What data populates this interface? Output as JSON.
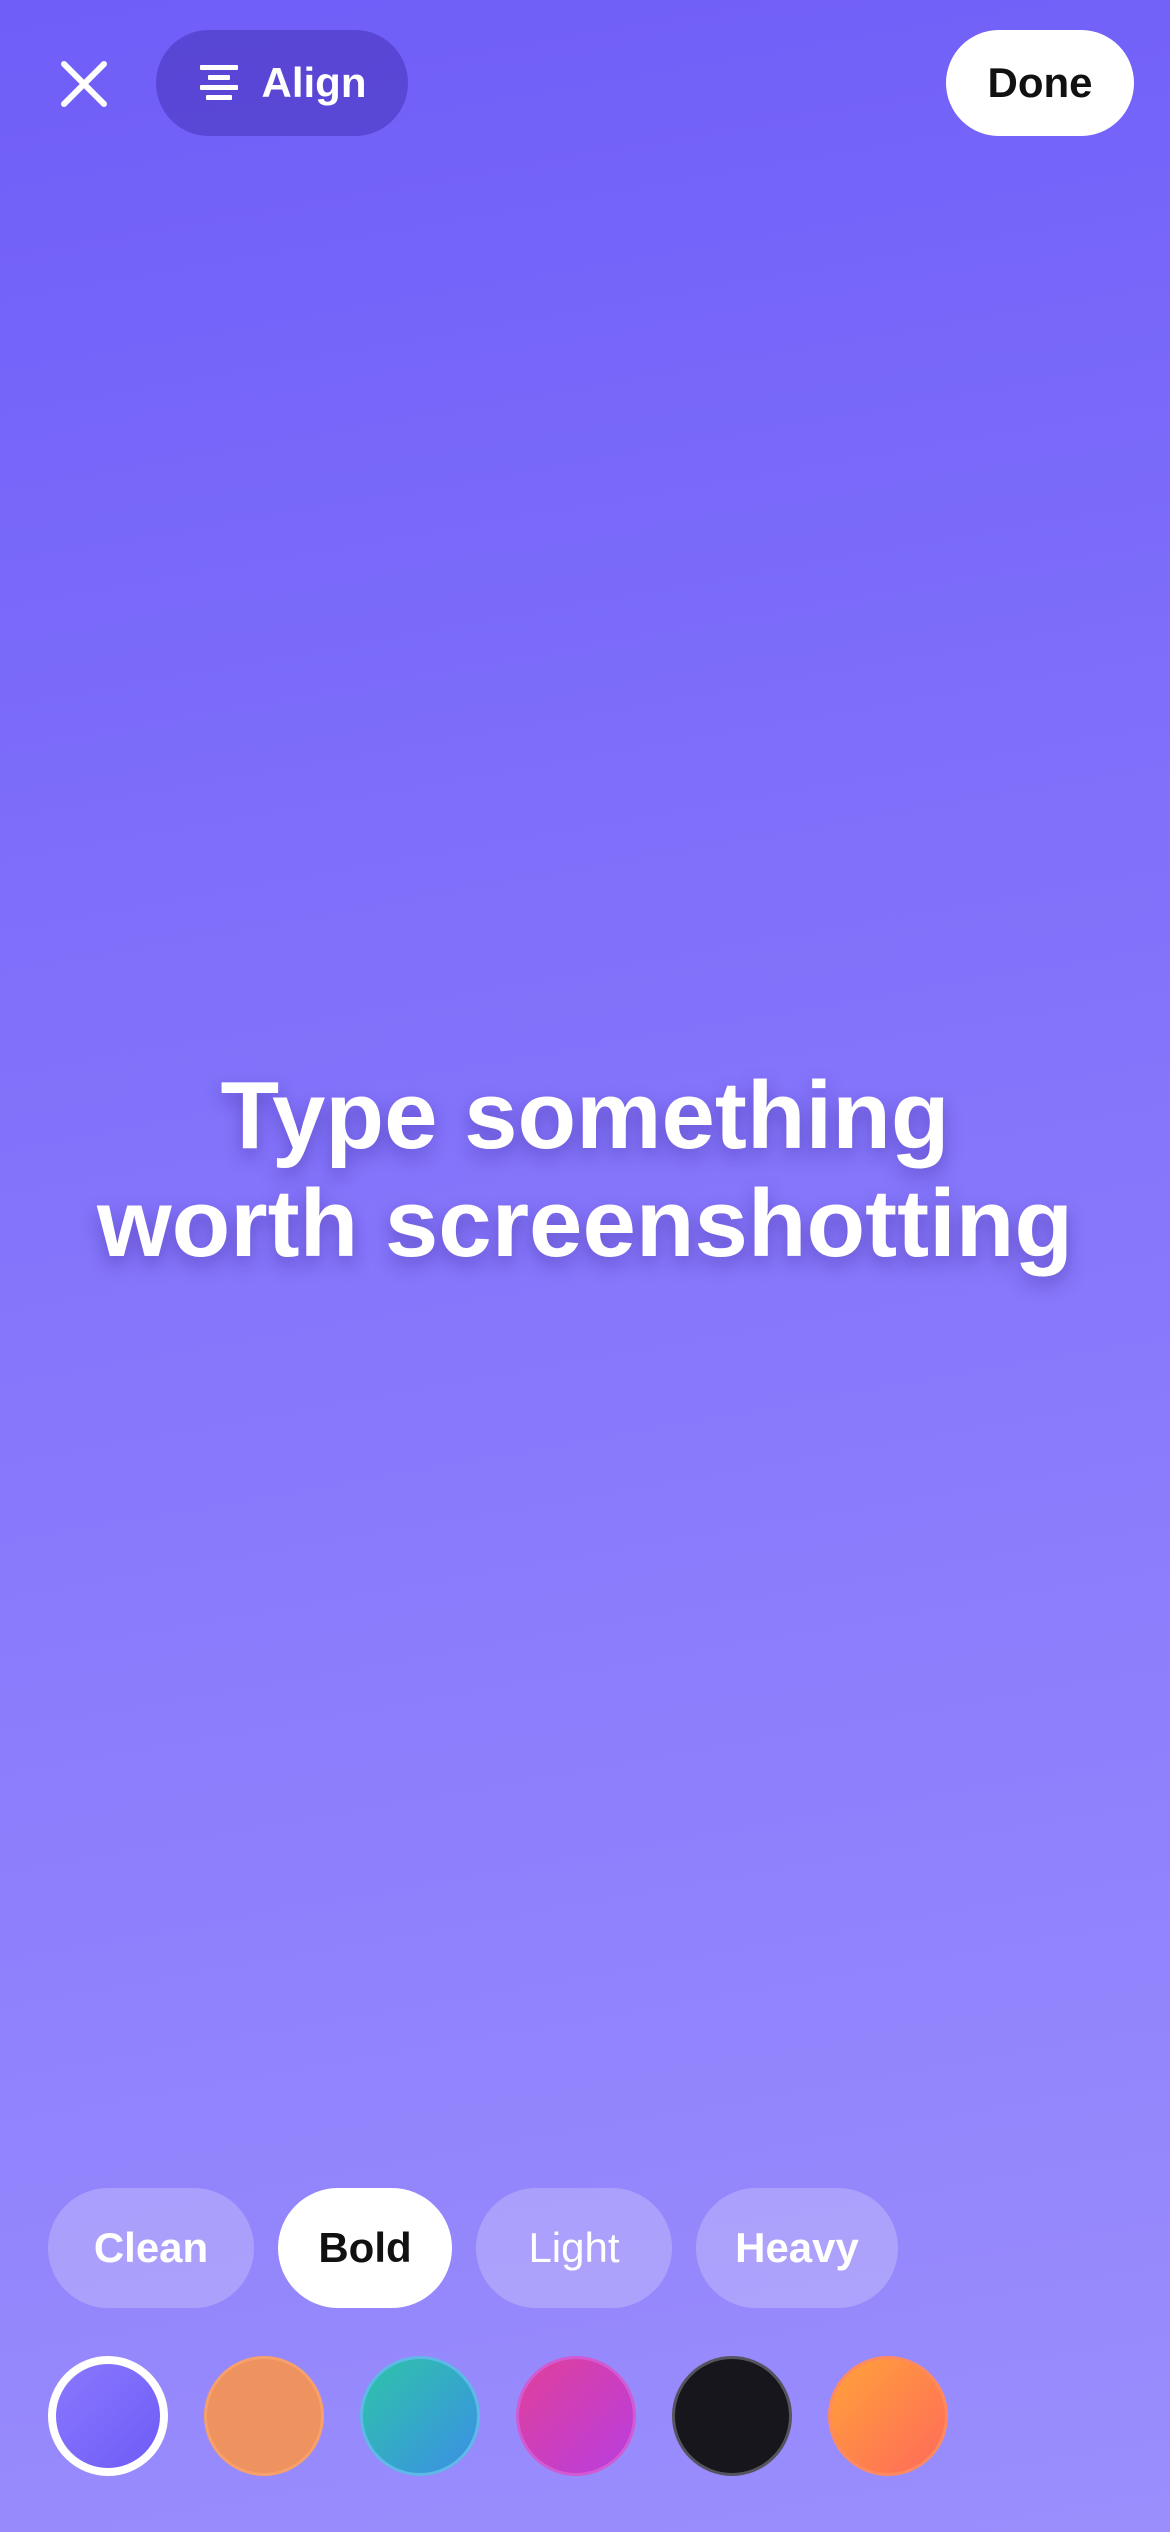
{
  "toolbar": {
    "close_icon": "close-icon",
    "align_icon": "align-center-icon",
    "align_label": "Align",
    "done_label": "Done"
  },
  "canvas": {
    "line1": "Type something",
    "line2": "worth screenshotting",
    "background_gradient": [
      "#6f5ef8",
      "#9a8efd"
    ]
  },
  "font_styles": {
    "selected": "Bold",
    "items": [
      {
        "label": "Clean"
      },
      {
        "label": "Bold"
      },
      {
        "label": "Light"
      },
      {
        "label": "Heavy"
      }
    ]
  },
  "color_swatches": {
    "selected": "violet",
    "items": [
      {
        "name": "violet",
        "colors": [
          "#8a78ff",
          "#6e5cf6"
        ]
      },
      {
        "name": "orange",
        "colors": [
          "#ee9260"
        ]
      },
      {
        "name": "teal",
        "colors": [
          "#2ec4a8",
          "#3b8fe6"
        ]
      },
      {
        "name": "magenta",
        "colors": [
          "#e0409a",
          "#b83de0"
        ]
      },
      {
        "name": "black",
        "colors": [
          "#17161d"
        ]
      },
      {
        "name": "sunset",
        "colors": [
          "#ffa23a",
          "#ff6a5a"
        ]
      }
    ]
  }
}
